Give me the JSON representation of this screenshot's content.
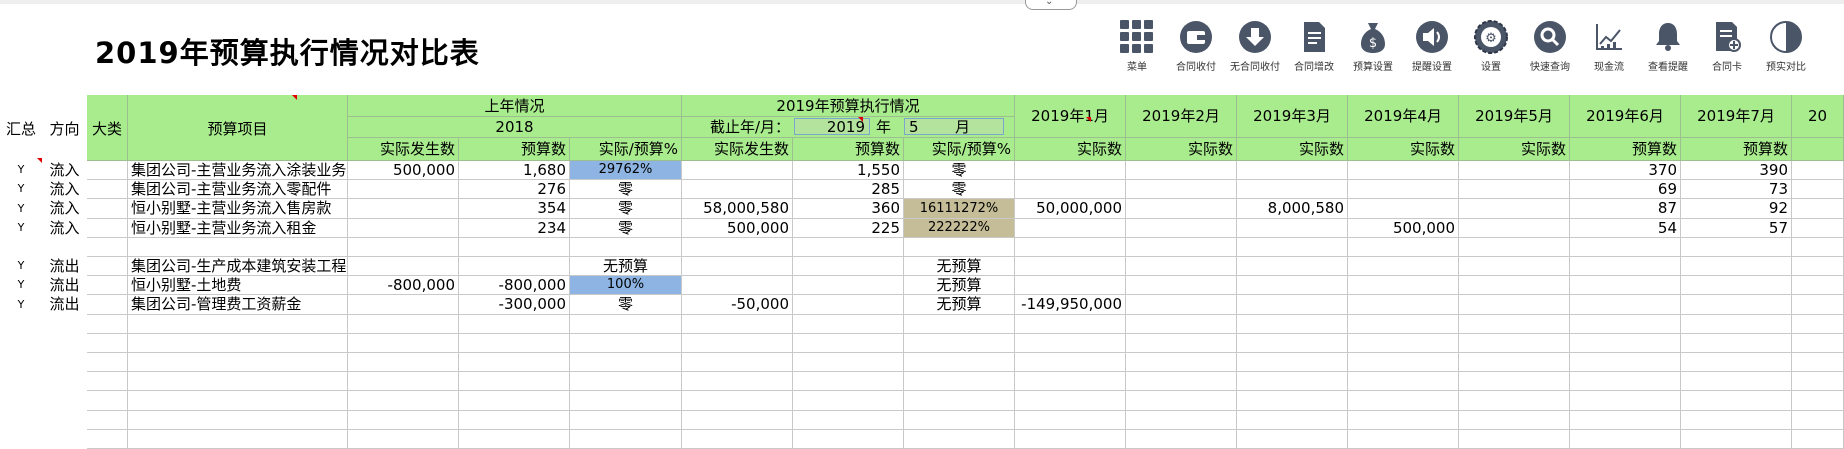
{
  "title": "2019年预算执行情况对比表",
  "toolbar": [
    {
      "label": "菜单",
      "icon": "grid-menu-icon"
    },
    {
      "label": "合同收付",
      "icon": "wallet-icon"
    },
    {
      "label": "无合同收付",
      "icon": "download-circle-icon"
    },
    {
      "label": "合同增改",
      "icon": "document-edit-icon"
    },
    {
      "label": "预算设置",
      "icon": "money-bag-icon"
    },
    {
      "label": "提醒设置",
      "icon": "speaker-icon"
    },
    {
      "label": "设置",
      "icon": "settings-badge-icon"
    },
    {
      "label": "快速查询",
      "icon": "search-icon"
    },
    {
      "label": "现金流",
      "icon": "line-chart-icon"
    },
    {
      "label": "查看提醒",
      "icon": "bell-icon"
    },
    {
      "label": "合同卡",
      "icon": "contract-card-icon"
    },
    {
      "label": "预实对比",
      "icon": "half-circle-icon"
    }
  ],
  "header": {
    "summary": "汇总",
    "direction": "方向",
    "category": "大类",
    "item": "预算项目",
    "prev_year": "上年情况",
    "prev_year_value": "2018",
    "exec": "2019年预算执行情况",
    "cutoff_label": "截止年/月：",
    "cutoff_year": "2019",
    "year_unit": "年",
    "cutoff_month": "5",
    "month_unit": "月",
    "months": [
      "2019年1月",
      "2019年2月",
      "2019年3月",
      "2019年4月",
      "2019年5月",
      "2019年6月",
      "2019年7月",
      "20"
    ],
    "sub": [
      "实际发生数",
      "预算数",
      "实际/预算%",
      "实际发生数",
      "预算数",
      "实际/预算%",
      "实际数",
      "实际数",
      "实际数",
      "实际数",
      "实际数",
      "预算数",
      "预算数"
    ]
  },
  "rows": [
    {
      "y": "Y",
      "dir": "流入",
      "cat": "",
      "item": "集团公司-主营业务流入涂装业务",
      "pa": "500,000",
      "pb": "1,680",
      "pr": "29762%",
      "ea": "",
      "eb": "1,550",
      "er": "零",
      "m1": "",
      "m2": "",
      "m3": "",
      "m4": "",
      "m5": "",
      "m6": "370",
      "m7": "390"
    },
    {
      "y": "Y",
      "dir": "流入",
      "cat": "",
      "item": "集团公司-主营业务流入零配件",
      "pa": "",
      "pb": "276",
      "pr": "零",
      "ea": "",
      "eb": "285",
      "er": "零",
      "m1": "",
      "m2": "",
      "m3": "",
      "m4": "",
      "m5": "",
      "m6": "69",
      "m7": "73"
    },
    {
      "y": "Y",
      "dir": "流入",
      "cat": "",
      "item": "恒小别墅-主营业务流入售房款",
      "pa": "",
      "pb": "354",
      "pr": "零",
      "ea": "58,000,580",
      "eb": "360",
      "er": "16111272%",
      "m1": "50,000,000",
      "m2": "",
      "m3": "8,000,580",
      "m4": "",
      "m5": "",
      "m6": "87",
      "m7": "92"
    },
    {
      "y": "Y",
      "dir": "流入",
      "cat": "",
      "item": "恒小别墅-主营业务流入租金",
      "pa": "",
      "pb": "234",
      "pr": "零",
      "ea": "500,000",
      "eb": "225",
      "er": "222222%",
      "m1": "",
      "m2": "",
      "m3": "",
      "m4": "500,000",
      "m5": "",
      "m6": "54",
      "m7": "57"
    },
    {
      "y": "",
      "dir": "",
      "cat": "",
      "item": "",
      "pa": "",
      "pb": "",
      "pr": "",
      "ea": "",
      "eb": "",
      "er": "",
      "m1": "",
      "m2": "",
      "m3": "",
      "m4": "",
      "m5": "",
      "m6": "",
      "m7": ""
    },
    {
      "y": "Y",
      "dir": "流出",
      "cat": "",
      "item": "集团公司-生产成本建筑安装工程",
      "pa": "",
      "pb": "",
      "pr": "无预算",
      "ea": "",
      "eb": "",
      "er": "无预算",
      "m1": "",
      "m2": "",
      "m3": "",
      "m4": "",
      "m5": "",
      "m6": "",
      "m7": ""
    },
    {
      "y": "Y",
      "dir": "流出",
      "cat": "",
      "item": "恒小别墅-土地费",
      "pa": "-800,000",
      "pb": "-800,000",
      "pr": "100%",
      "ea": "",
      "eb": "",
      "er": "无预算",
      "m1": "",
      "m2": "",
      "m3": "",
      "m4": "",
      "m5": "",
      "m6": "",
      "m7": ""
    },
    {
      "y": "Y",
      "dir": "流出",
      "cat": "",
      "item": "集团公司-管理费工资薪金",
      "pa": "",
      "pb": "-300,000",
      "pr": "零",
      "ea": "-50,000",
      "eb": "",
      "er": "无预算",
      "m1": "-149,950,000",
      "m2": "",
      "m3": "",
      "m4": "",
      "m5": "",
      "m6": "",
      "m7": ""
    }
  ],
  "highlights": {
    "pr_blue": [
      0,
      6
    ],
    "er_tan": [
      2,
      3
    ]
  },
  "colors": {
    "header_green": "#a9ec8e",
    "pct_blue": "#8db4e2",
    "pct_tan": "#c4bd97",
    "comment_red": "#e00000"
  }
}
